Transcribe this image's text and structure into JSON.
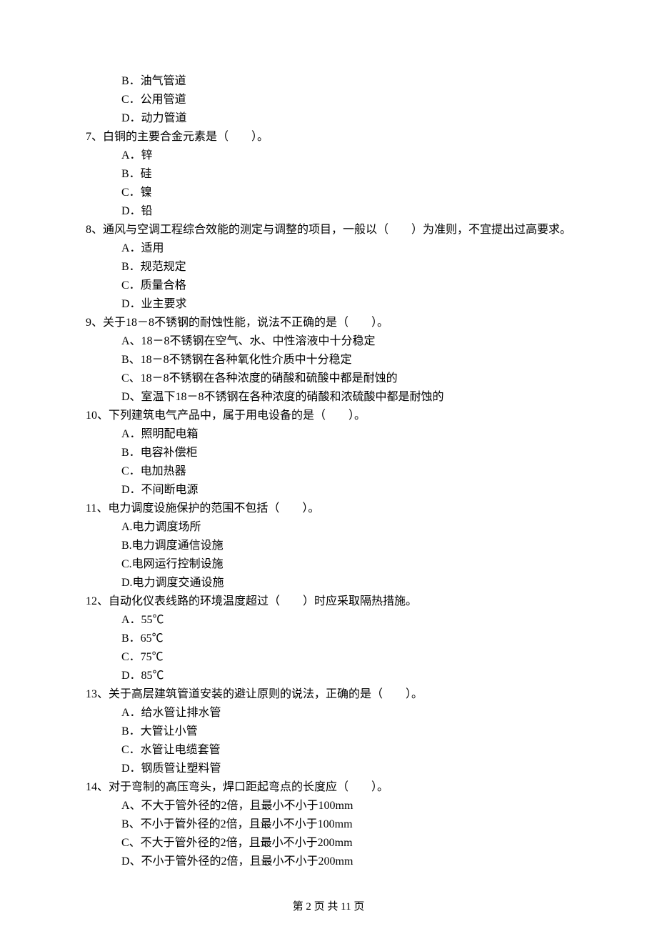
{
  "continued_options": [
    "B．油气管道",
    "C．公用管道",
    "D．动力管道"
  ],
  "questions": [
    {
      "stem": "7、白铜的主要合金元素是（　　）。",
      "options": [
        "A．锌",
        "B．硅",
        "C．镍",
        "D．铅"
      ]
    },
    {
      "stem": "8、通风与空调工程综合效能的测定与调整的项目，一般以（　　）为准则，不宜提出过高要求。",
      "options": [
        "A．适用",
        "B．规范规定",
        "C．质量合格",
        "D．业主要求"
      ]
    },
    {
      "stem": "9、关于18－8不锈钢的耐蚀性能，说法不正确的是（　　）。",
      "options": [
        "A、18－8不锈钢在空气、水、中性溶液中十分稳定",
        "B、18－8不锈钢在各种氧化性介质中十分稳定",
        "C、18－8不锈钢在各种浓度的硝酸和硫酸中都是耐蚀的",
        "D、室温下18－8不锈钢在各种浓度的硝酸和浓硫酸中都是耐蚀的"
      ]
    },
    {
      "stem": "10、下列建筑电气产品中，属于用电设备的是（　　）。",
      "options": [
        "A．照明配电箱",
        "B．电容补偿柜",
        "C．电加热器",
        "D．不间断电源"
      ]
    },
    {
      "stem": "11、电力调度设施保护的范围不包括（　　）。",
      "options": [
        "A.电力调度场所",
        "B.电力调度通信设施",
        "C.电网运行控制设施",
        "D.电力调度交通设施"
      ]
    },
    {
      "stem": "12、自动化仪表线路的环境温度超过（　　）时应采取隔热措施。",
      "options": [
        "A．55℃",
        "B．65℃",
        "C．75℃",
        "D．85℃"
      ]
    },
    {
      "stem": "13、关于高层建筑管道安装的避让原则的说法，正确的是（　　）。",
      "options": [
        "A．给水管让排水管",
        "B．大管让小管",
        "C．水管让电缆套管",
        "D．钢质管让塑料管"
      ]
    },
    {
      "stem": "14、对于弯制的高压弯头，焊口距起弯点的长度应（　　）。",
      "options": [
        "A、不大于管外径的2倍，且最小不小于100mm",
        "B、不小于管外径的2倍，且最小不小于100mm",
        "C、不大于管外径的2倍，且最小不小于200mm",
        "D、不小于管外径的2倍，且最小不小于200mm"
      ]
    }
  ],
  "footer": "第 2 页 共 11 页"
}
